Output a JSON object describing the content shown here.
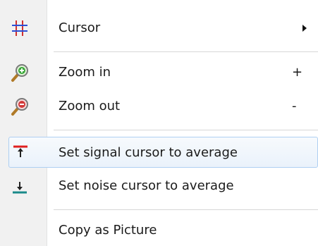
{
  "menu": {
    "items": [
      {
        "label": "Cursor",
        "shortcut": "",
        "icon": "grid-cursor-icon",
        "submenu": true
      },
      {
        "label": "Zoom in",
        "shortcut": "+",
        "icon": "zoom-in-icon"
      },
      {
        "label": "Zoom out",
        "shortcut": "-",
        "icon": "zoom-out-icon"
      },
      {
        "label": "Set signal cursor to average",
        "shortcut": "",
        "icon": "signal-cursor-icon",
        "highlighted": true
      },
      {
        "label": "Set noise cursor to average",
        "shortcut": "",
        "icon": "noise-cursor-icon"
      },
      {
        "label": "Copy as Picture",
        "shortcut": "",
        "icon": ""
      }
    ]
  },
  "colors": {
    "gutter": "#f1f1f1",
    "highlight_border": "#aecff2",
    "signal_red": "#e02020",
    "noise_teal": "#1a8a8a"
  }
}
